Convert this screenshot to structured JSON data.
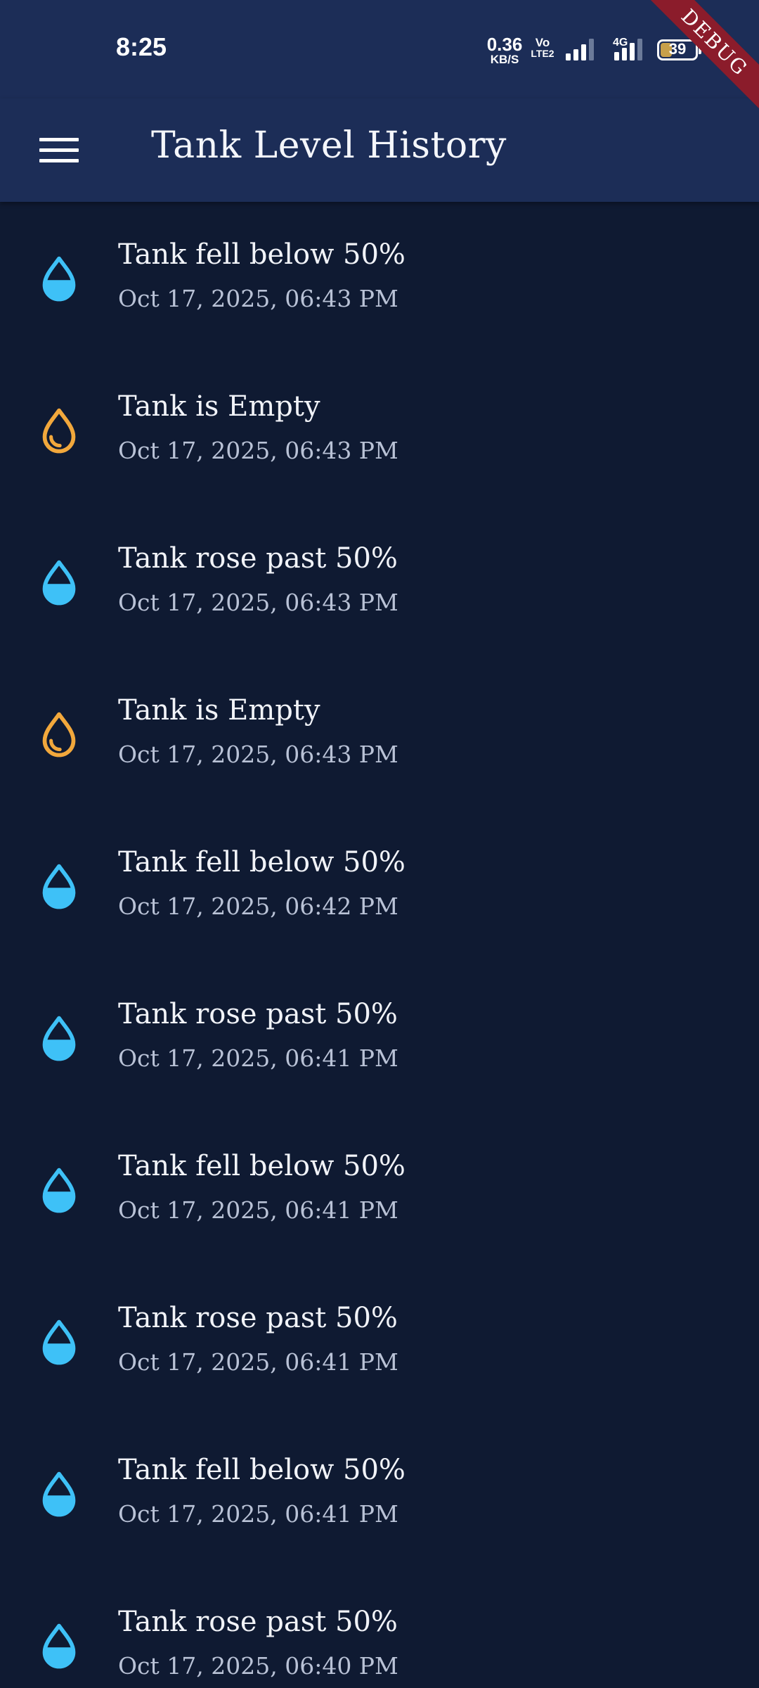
{
  "status_bar": {
    "time": "8:25",
    "net_speed_value": "0.36",
    "net_speed_unit": "KB/S",
    "volte_top": "Vo",
    "volte_bottom": "LTE2",
    "network_type": "4G",
    "battery_percent": "39",
    "battery_level": 0.39
  },
  "debug_banner": "DEBUG",
  "app_bar": {
    "menu_icon": "menu-icon",
    "title": "Tank Level History"
  },
  "colors": {
    "background": "#0f1a32",
    "app_bar": "#1c2d57",
    "drop_filled": "#3ec1f7",
    "drop_empty": "#f2a83c",
    "debug": "#8b1c2b"
  },
  "history": [
    {
      "title": "Tank fell below 50%",
      "time": "Oct 17, 2025, 06:43 PM",
      "icon": "water-drop-half-icon"
    },
    {
      "title": "Tank is Empty",
      "time": "Oct 17, 2025, 06:43 PM",
      "icon": "water-drop-empty-icon"
    },
    {
      "title": "Tank rose past 50%",
      "time": "Oct 17, 2025, 06:43 PM",
      "icon": "water-drop-half-icon"
    },
    {
      "title": "Tank is Empty",
      "time": "Oct 17, 2025, 06:43 PM",
      "icon": "water-drop-empty-icon"
    },
    {
      "title": "Tank fell below 50%",
      "time": "Oct 17, 2025, 06:42 PM",
      "icon": "water-drop-half-icon"
    },
    {
      "title": "Tank rose past 50%",
      "time": "Oct 17, 2025, 06:41 PM",
      "icon": "water-drop-half-icon"
    },
    {
      "title": "Tank fell below 50%",
      "time": "Oct 17, 2025, 06:41 PM",
      "icon": "water-drop-half-icon"
    },
    {
      "title": "Tank rose past 50%",
      "time": "Oct 17, 2025, 06:41 PM",
      "icon": "water-drop-half-icon"
    },
    {
      "title": "Tank fell below 50%",
      "time": "Oct 17, 2025, 06:41 PM",
      "icon": "water-drop-half-icon"
    },
    {
      "title": "Tank rose past 50%",
      "time": "Oct 17, 2025, 06:40 PM",
      "icon": "water-drop-half-icon"
    }
  ]
}
